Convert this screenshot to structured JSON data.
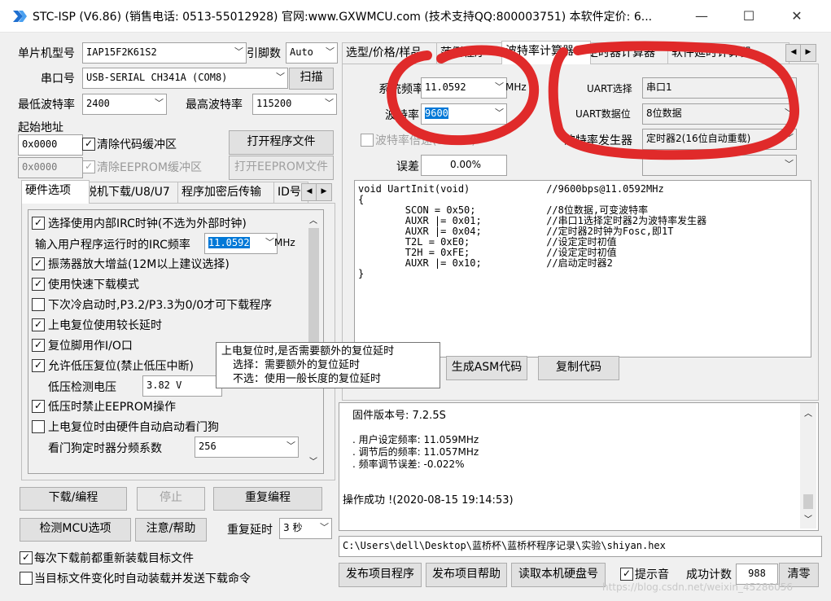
{
  "window": {
    "title": "STC-ISP (V6.86) (销售电话: 0513-55012928) 官网:www.GXWMCU.com  (技术支持QQ:800003751) 本软件定价: 6...",
    "minimize": "—",
    "maximize": "☐",
    "close": "✕"
  },
  "left": {
    "mcu_label": "单片机型号",
    "mcu_value": "IAP15F2K61S2",
    "pin_label": "引脚数",
    "pin_value": "Auto",
    "port_label": "串口号",
    "port_value": "USB-SERIAL CH341A (COM8)",
    "scan_btn": "扫描",
    "min_baud_label": "最低波特率",
    "min_baud_value": "2400",
    "max_baud_label": "最高波特率",
    "max_baud_value": "115200",
    "start_addr_label": "起始地址",
    "addr1": "0x0000",
    "clear_code": "清除代码缓冲区",
    "open_prog": "打开程序文件",
    "addr2": "0x0000",
    "clear_eeprom": "清除EEPROM缓冲区",
    "open_eeprom": "打开EEPROM文件",
    "tabs": [
      "硬件选项",
      "脱机下载/U8/U7",
      "程序加密后传输",
      "ID号"
    ],
    "options": {
      "opt1": "选择使用内部IRC时钟(不选为外部时钟)",
      "irc_label": "输入用户程序运行时的IRC频率",
      "irc_value": "11.0592",
      "irc_unit": "MHz",
      "opt2": "振荡器放大增益(12M以上建议选择)",
      "opt3": "使用快速下载模式",
      "opt4": "下次冷启动时,P3.2/P3.3为0/0才可下载程序",
      "opt5": "上电复位使用较长延时",
      "opt6": "复位脚用作I/O口",
      "opt7": "允许低压复位(禁止低压中断)",
      "lv_label": "低压检测电压",
      "lv_value": "3.82 V",
      "opt8": "低压时禁止EEPROM操作",
      "opt9": "上电复位时由硬件自动启动看门狗",
      "wdt_label": "看门狗定时器分频系数",
      "wdt_value": "256"
    },
    "download_btn": "下载/编程",
    "stop_btn": "停止",
    "reprogram_btn": "重复编程",
    "check_btn": "检测MCU选项",
    "help_btn": "注意/帮助",
    "delay_label": "重复延时",
    "delay_value": "3 秒",
    "reload_each": "每次下载前都重新装载目标文件",
    "auto_reload": "当目标文件变化时自动装载并发送下载命令"
  },
  "tooltip": {
    "line1": "上电复位时,是否需要额外的复位延时",
    "line2": "选择：需要额外的复位延时",
    "line3": "不选：使用一般长度的复位延时"
  },
  "right": {
    "tabs": [
      "选型/价格/样品",
      "范例程序",
      "波特率计算器",
      "定时器计算器",
      "软件延时计算器"
    ],
    "sys_freq_label": "系统频率",
    "sys_freq_value": "11.0592",
    "freq_unit": "MHz",
    "baud_label": "波特率",
    "baud_value": "9600",
    "baud_double": "波特率倍速(SMOD)",
    "error_label": "误差",
    "error_value": "0.00%",
    "uart_sel_label": "UART选择",
    "uart_sel_value": "串口1",
    "uart_bits_label": "UART数据位",
    "uart_bits_value": "8位数据",
    "baud_gen_label": "波特率发生器",
    "baud_gen_value": "定时器2(16位自动重载)",
    "code": "void UartInit(void)\t\t//9600bps@11.0592MHz\n{\n\tSCON = 0x50;\t\t//8位数据,可变波特率\n\tAUXR |= 0x01;\t\t//串口1选择定时器2为波特率发生器\n\tAUXR |= 0x04;\t\t//定时器2时钟为Fosc,即1T\n\tT2L = 0xE0;\t\t//设定定时初值\n\tT2H = 0xFE;\t\t//设定定时初值\n\tAUXR |= 0x10;\t\t//启动定时器2\n}",
    "gen_asm": "生成ASM代码",
    "copy_code": "复制代码",
    "output": {
      "firmware": "固件版本号: 7.2.5S",
      "user_freq": ". 用户设定频率: 11.059MHz",
      "adj_freq": ". 调节后的频率: 11.057MHz",
      "freq_err": ". 频率调节误差: -0.022%",
      "success": "操作成功 !(2020-08-15 19:14:53)"
    },
    "path": "C:\\Users\\dell\\Desktop\\蓝桥杯\\蓝桥杯程序记录\\实验\\shiyan.hex",
    "publish_prog": "发布项目程序",
    "publish_help": "发布项目帮助",
    "read_disk": "读取本机硬盘号",
    "beep": "提示音",
    "count_label": "成功计数",
    "count_value": "988",
    "clear_btn": "清零"
  },
  "watermark": "https://blog.csdn.net/weixin_45286056",
  "colors": {
    "annotation": "#e02a2a",
    "selection": "#0078d7"
  }
}
